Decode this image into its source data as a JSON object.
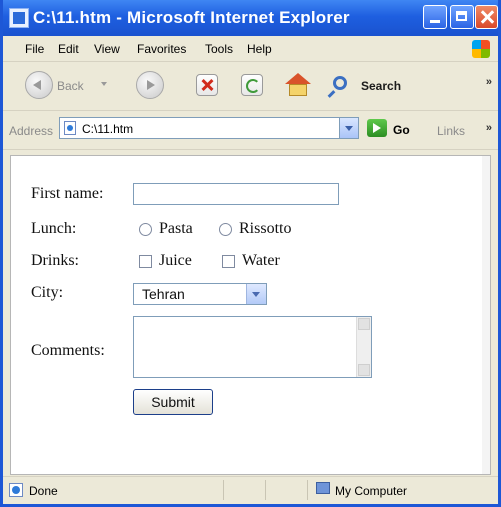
{
  "window": {
    "title": "C:\\11.htm - Microsoft Internet Explorer"
  },
  "menu": [
    "File",
    "Edit",
    "View",
    "Favorites",
    "Tools",
    "Help"
  ],
  "toolbar": {
    "back_label": "Back",
    "search_label": "Search",
    "more": "»"
  },
  "address": {
    "label": "Address",
    "url": "C:\\11.htm",
    "go_label": "Go",
    "links_label": "Links",
    "more": "»"
  },
  "form": {
    "first_name_label": "First name:",
    "first_name_value": "",
    "lunch_label": "Lunch:",
    "lunch_options": [
      "Pasta",
      "Rissotto"
    ],
    "drinks_label": "Drinks:",
    "drinks_options": [
      "Juice",
      "Water"
    ],
    "city_label": "City:",
    "city_value": "Tehran",
    "comments_label": "Comments:",
    "comments_value": "",
    "submit_label": "Submit"
  },
  "status": {
    "text": "Done",
    "zone": "My Computer"
  },
  "colors": {
    "titlebar": "#1e5fe0",
    "chrome": "#ece9d8",
    "content_bg": "#ffffff"
  }
}
